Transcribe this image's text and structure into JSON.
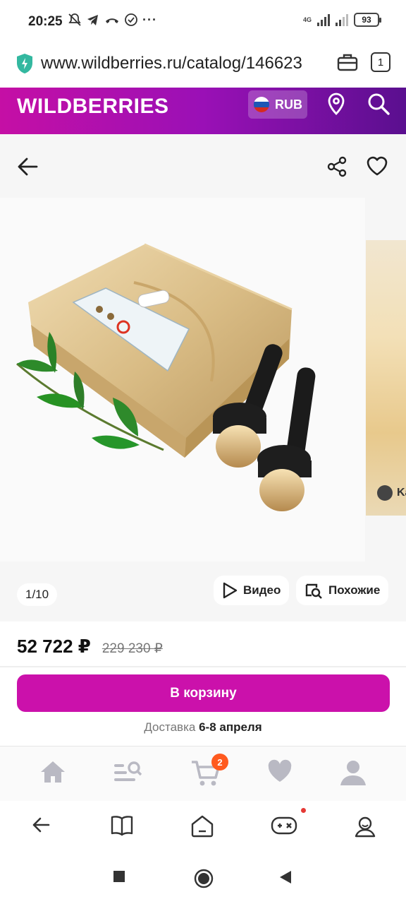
{
  "status_bar": {
    "time": "20:25",
    "network": "4G",
    "battery": "93"
  },
  "browser": {
    "url": "www.wildberries.ru/catalog/146623",
    "tab_count": "1"
  },
  "header": {
    "logo": "WILDBERRIES",
    "currency": "RUB"
  },
  "gallery": {
    "counter": "1/10",
    "video_label": "Видео",
    "similar_label": "Похожие",
    "side_preview_text": "Ka"
  },
  "price": {
    "current": "52 722 ₽",
    "old": "229 230 ₽"
  },
  "cart": {
    "button_label": "В корзину",
    "delivery_prefix": "Доставка",
    "delivery_dates": "6-8 апреля"
  },
  "site_nav": {
    "cart_badge": "2"
  },
  "colors": {
    "brand": "#cb11ab",
    "header_gradient_end": "#5a0f8f",
    "badge": "#ff5a1f"
  }
}
